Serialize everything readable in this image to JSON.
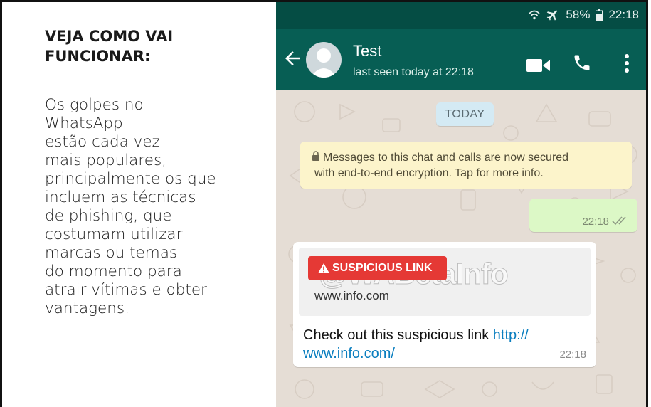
{
  "article": {
    "headline_lines": [
      "VEJA COMO VAI",
      "FUNCIONAR:"
    ],
    "body_lines": [
      "Os golpes no",
      "WhatsApp",
      "estão cada vez",
      "mais populares,",
      "principalmente os que",
      "incluem as técnicas",
      "de phishing, que",
      "costumam utilizar",
      "marcas ou temas",
      "do momento para",
      "atrair vítimas e obter",
      "vantagens."
    ]
  },
  "statusbar": {
    "battery": "58%",
    "time": "22:18",
    "icons": [
      "wifi-icon",
      "airplane-mode-icon",
      "battery-icon"
    ]
  },
  "appbar": {
    "contact_name": "Test",
    "last_seen": "last seen today at 22:18",
    "icons": [
      "back-arrow-icon",
      "video-call-icon",
      "phone-icon",
      "more-vert-icon"
    ]
  },
  "chat": {
    "date_chip": "TODAY",
    "encryption_lines": [
      "Messages to this chat and calls are now secured",
      "with end-to-end encryption. Tap for more info."
    ],
    "outgoing": {
      "time": "22:18"
    },
    "incoming": {
      "badge": "SUSPICIOUS LINK",
      "watermark": "@WABetaInfo",
      "preview_url": "www.info.com",
      "text": "Check out this suspicious link ",
      "link_part1": "http://",
      "link_part2": "www.info.com/",
      "time": "22:18"
    }
  },
  "colors": {
    "header": "#075e54",
    "statusbar": "#054d44",
    "chat_bg": "#e5ddd5",
    "outgoing_bubble": "#dcf8c6",
    "badge_red": "#e53935",
    "link_blue": "#0a7ebf"
  }
}
